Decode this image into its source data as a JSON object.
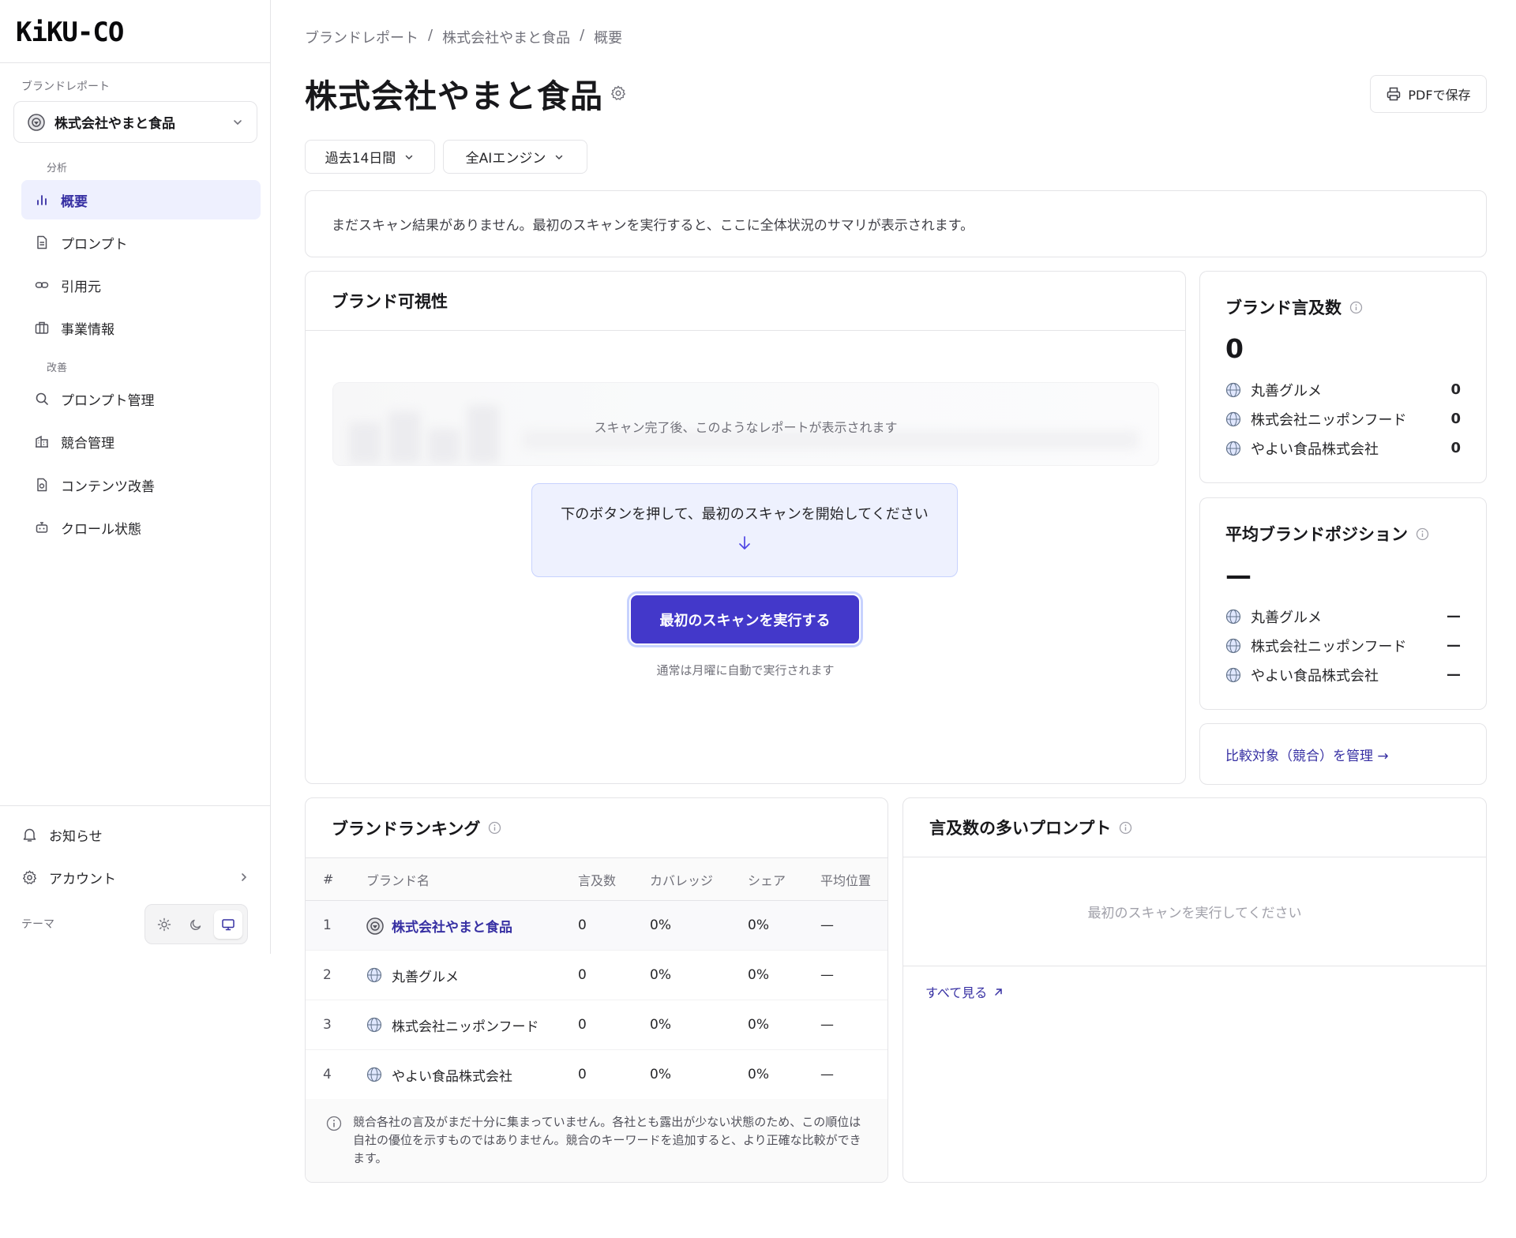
{
  "app": {
    "logo": "KiKU-CO"
  },
  "sidebar": {
    "section_label": "ブランドレポート",
    "brand_selector": "株式会社やまと食品",
    "groups": [
      {
        "label": "分析",
        "items": [
          {
            "label": "概要",
            "icon": "bar-chart-icon",
            "active": true
          },
          {
            "label": "プロンプト",
            "icon": "document-icon"
          },
          {
            "label": "引用元",
            "icon": "link-icon"
          },
          {
            "label": "事業情報",
            "icon": "briefcase-icon"
          }
        ]
      },
      {
        "label": "改善",
        "items": [
          {
            "label": "プロンプト管理",
            "icon": "search-icon"
          },
          {
            "label": "競合管理",
            "icon": "building-icon"
          },
          {
            "label": "コンテンツ改善",
            "icon": "file-edit-icon"
          },
          {
            "label": "クロール状態",
            "icon": "robot-icon"
          }
        ]
      }
    ],
    "footer": {
      "notifications": "お知らせ",
      "account": "アカウント",
      "theme_label": "テーマ",
      "theme_selected": "system"
    }
  },
  "header": {
    "breadcrumb": [
      "ブランドレポート",
      "株式会社やまと食品",
      "概要"
    ],
    "title": "株式会社やまと食品",
    "pdf_button": "PDFで保存",
    "filters": {
      "period": "過去14日間",
      "engine": "全AIエンジン"
    }
  },
  "notice": "まだスキャン結果がありません。最初のスキャンを実行すると、ここに全体状況のサマリが表示されます。",
  "visibility": {
    "title": "ブランド可視性",
    "preview_text": "スキャン完了後、このようなレポートが表示されます",
    "cta_text": "下のボタンを押して、最初のスキャンを開始してください",
    "scan_button": "最初のスキャンを実行する",
    "scan_note": "通常は月曜に自動で実行されます"
  },
  "mentions": {
    "title": "ブランド言及数",
    "value": "0",
    "competitors": [
      {
        "name": "丸善グルメ",
        "value": "0"
      },
      {
        "name": "株式会社ニッポンフード",
        "value": "0"
      },
      {
        "name": "やよい食品株式会社",
        "value": "0"
      }
    ]
  },
  "position": {
    "title": "平均ブランドポジション",
    "value": "—",
    "competitors": [
      {
        "name": "丸善グルメ",
        "value": "—"
      },
      {
        "name": "株式会社ニッポンフード",
        "value": "—"
      },
      {
        "name": "やよい食品株式会社",
        "value": "—"
      }
    ]
  },
  "manage_link": "比較対象（競合）を管理 →",
  "ranking": {
    "title": "ブランドランキング",
    "columns": [
      "#",
      "ブランド名",
      "言及数",
      "カバレッジ",
      "シェア",
      "平均位置"
    ],
    "rows": [
      {
        "rank": "1",
        "name": "株式会社やまと食品",
        "mentions": "0",
        "coverage": "0%",
        "share": "0%",
        "position": "—",
        "own": true
      },
      {
        "rank": "2",
        "name": "丸善グルメ",
        "mentions": "0",
        "coverage": "0%",
        "share": "0%",
        "position": "—"
      },
      {
        "rank": "3",
        "name": "株式会社ニッポンフード",
        "mentions": "0",
        "coverage": "0%",
        "share": "0%",
        "position": "—"
      },
      {
        "rank": "4",
        "name": "やよい食品株式会社",
        "mentions": "0",
        "coverage": "0%",
        "share": "0%",
        "position": "—"
      }
    ],
    "footnote": "競合各社の言及がまだ十分に集まっていません。各社とも露出が少ない状態のため、この順位は自社の優位を示すものではありません。競合のキーワードを追加すると、より正確な比較ができます。"
  },
  "prompts": {
    "title": "言及数の多いプロンプト",
    "empty": "最初のスキャンを実行してください",
    "see_all": "すべて見る"
  },
  "colors": {
    "accent": "#4338ca",
    "active_bg": "#eef0fe",
    "border": "#e4e4e7"
  }
}
